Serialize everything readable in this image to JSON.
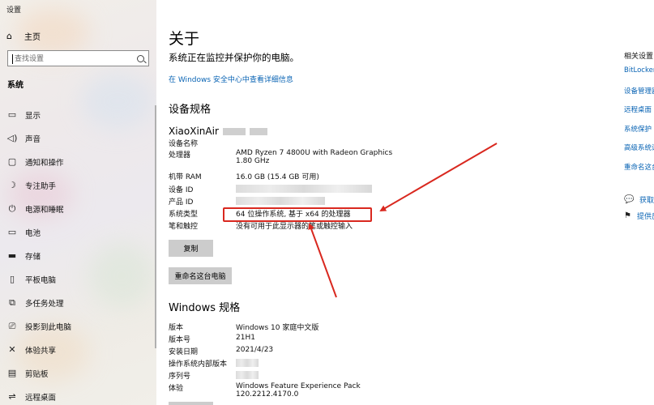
{
  "window": {
    "title": "设置"
  },
  "sidebar": {
    "home_label": "主页",
    "search_placeholder": "查找设置",
    "section": "系统",
    "items": [
      {
        "label": "显示",
        "icon": "display-icon"
      },
      {
        "label": "声音",
        "icon": "speaker-icon"
      },
      {
        "label": "通知和操作",
        "icon": "notification-icon"
      },
      {
        "label": "专注助手",
        "icon": "moon-icon"
      },
      {
        "label": "电源和睡眠",
        "icon": "power-icon"
      },
      {
        "label": "电池",
        "icon": "battery-icon"
      },
      {
        "label": "存储",
        "icon": "storage-icon"
      },
      {
        "label": "平板电脑",
        "icon": "tablet-icon"
      },
      {
        "label": "多任务处理",
        "icon": "multitask-icon"
      },
      {
        "label": "投影到此电脑",
        "icon": "project-icon"
      },
      {
        "label": "体验共享",
        "icon": "share-icon"
      },
      {
        "label": "剪贴板",
        "icon": "clipboard-icon"
      },
      {
        "label": "远程桌面",
        "icon": "remote-icon"
      }
    ]
  },
  "main": {
    "title": "关于",
    "protect_text": "系统正在监控并保护你的电脑。",
    "security_link": "在 Windows 安全中心中查看详细信息",
    "device_spec_heading": "设备规格",
    "device_name_big": "XiaoXinAir",
    "device_spec": [
      {
        "key": "设备名称",
        "value": ""
      },
      {
        "key": "处理器",
        "value": "AMD Ryzen 7 4800U with Radeon Graphics",
        "value2": "1.80 GHz"
      },
      {
        "key": "机带 RAM",
        "value": "16.0 GB (15.4 GB 可用)"
      },
      {
        "key": "设备 ID",
        "value": ""
      },
      {
        "key": "产品 ID",
        "value": ""
      },
      {
        "key": "系统类型",
        "value": "64 位操作系统, 基于 x64 的处理器"
      },
      {
        "key": "笔和触控",
        "value": "没有可用于此显示器的笔或触控输入"
      }
    ],
    "copy_button": "复制",
    "rename_button": "重命名这台电脑",
    "windows_spec_heading": "Windows 规格",
    "windows_spec": [
      {
        "key": "版本",
        "value": "Windows 10 家庭中文版"
      },
      {
        "key": "版本号",
        "value": "21H1"
      },
      {
        "key": "安装日期",
        "value": "2021/4/23"
      },
      {
        "key": "操作系统内部版本",
        "value": ""
      },
      {
        "key": "序列号",
        "value": ""
      },
      {
        "key": "体验",
        "value": "Windows Feature Experience Pack 120.2212.4170.0"
      }
    ]
  },
  "related": {
    "heading": "相关设置",
    "links": [
      "BitLocker",
      "设备管理器",
      "远程桌面",
      "系统保护",
      "高级系统设置",
      "重命名这台电脑"
    ]
  },
  "help": [
    {
      "label": "获取帮助",
      "icon": "chat-icon"
    },
    {
      "label": "提供反馈",
      "icon": "feedback-icon"
    }
  ],
  "colors": {
    "accent": "#0a64b4",
    "annotation": "#d9281f"
  }
}
